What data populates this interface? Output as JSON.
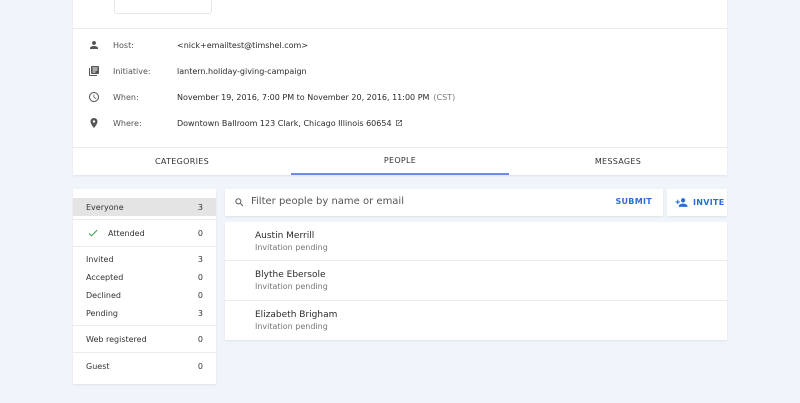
{
  "event": {
    "date_fragments": [
      "2016",
      "2016"
    ],
    "details": [
      {
        "icon": "person-icon",
        "label": "Host:",
        "value": "<nick+emailtest@timshel.com>",
        "extra": ""
      },
      {
        "icon": "library-books-icon",
        "label": "Initiative:",
        "value": "lantern.holiday-giving-campaign",
        "extra": ""
      },
      {
        "icon": "clock-icon",
        "label": "When:",
        "value": "November 19, 2016, 7:00 PM to November 20, 2016, 11:00 PM",
        "extra": "(CST)"
      },
      {
        "icon": "location-pin-icon",
        "label": "Where:",
        "value": "Downtown Ballroom 123 Clark, Chicago Illinois 60654",
        "extra": ""
      }
    ]
  },
  "tabs": [
    {
      "label": "CATEGORIES",
      "active": false
    },
    {
      "label": "PEOPLE",
      "active": true
    },
    {
      "label": "MESSAGES",
      "active": false
    }
  ],
  "filters": {
    "everyone": {
      "label": "Everyone",
      "count": "3"
    },
    "attended": {
      "label": "Attended",
      "count": "0"
    },
    "invited": {
      "label": "Invited",
      "count": "3"
    },
    "accepted": {
      "label": "Accepted",
      "count": "0"
    },
    "declined": {
      "label": "Declined",
      "count": "0"
    },
    "pending": {
      "label": "Pending",
      "count": "3"
    },
    "web_registered": {
      "label": "Web registered",
      "count": "0"
    },
    "guest": {
      "label": "Guest",
      "count": "0"
    }
  },
  "search": {
    "placeholder": "Filter people by name or email",
    "submit_label": "SUBMIT",
    "icon": "search-icon"
  },
  "invite": {
    "label": "INVITE",
    "icon": "person-add-icon"
  },
  "colors": {
    "accent": "#2b6fd6",
    "tab_underline": "#6c8de6",
    "attended_check": "#2e9e4a",
    "background": "#f0f4fb"
  },
  "people": [
    {
      "name": "Austin Merrill",
      "status": "Invitation pending"
    },
    {
      "name": "Blythe Ebersole",
      "status": "Invitation pending"
    },
    {
      "name": "Elizabeth Brigham",
      "status": "Invitation pending"
    }
  ]
}
